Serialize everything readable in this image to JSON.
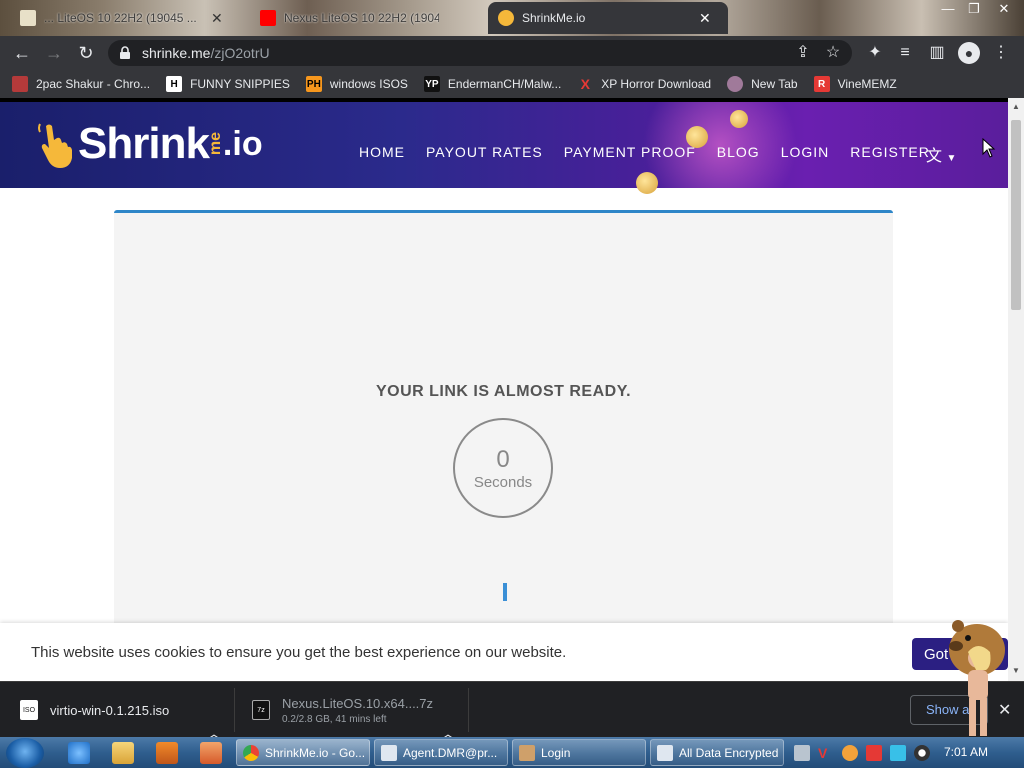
{
  "browser": {
    "tabs": [
      {
        "title": "... LiteOS 10 22H2 (19045 ..."
      },
      {
        "title": "Nexus LiteOS 10 22H2 (19045 ..."
      },
      {
        "title": "ShrinkMe.io"
      }
    ],
    "url_host": "shrinke.me",
    "url_path": "/zjO2otrU",
    "bookmarks": [
      {
        "label": "2pac Shakur - Chro...",
        "icon": "music-icon",
        "color": "#b43a3a"
      },
      {
        "label": "FUNNY SNIPPIES",
        "icon": "H",
        "color": "#ffffff"
      },
      {
        "label": "windows ISOS",
        "icon": "PH",
        "color": "#f7971d"
      },
      {
        "label": "EndermanCH/Malw...",
        "icon": "YP",
        "color": "#111111"
      },
      {
        "label": "XP Horror Download",
        "icon": "X",
        "color": "#e53935"
      },
      {
        "label": "New Tab",
        "icon": "avatar-icon",
        "color": "#a07a9a"
      },
      {
        "label": "VineMEMZ",
        "icon": "R",
        "color": "#e53935"
      }
    ]
  },
  "site": {
    "logo_word": "Shrink",
    "logo_me": "me",
    "logo_io": ".io",
    "nav": [
      "HOME",
      "PAYOUT RATES",
      "PAYMENT PROOF",
      "BLOG",
      "LOGIN",
      "REGISTER"
    ],
    "ready_text": "YOUR LINK IS ALMOST READY.",
    "timer_value": "0",
    "timer_label": "Seconds",
    "cookie_message": "This website uses cookies to ensure you get the best experience on our website.",
    "cookie_button": "Got it"
  },
  "downloads": [
    {
      "name": "virtio-win-0.1.215.iso",
      "status": "",
      "type": "ISO"
    },
    {
      "name": "Nexus.LiteOS.10.x64....7z",
      "status": "0.2/2.8 GB, 41 mins left",
      "type": "7z"
    }
  ],
  "downloads_show_all": "Show all",
  "taskbar": {
    "tasks": [
      {
        "label": "ShrinkMe.io - Go..."
      },
      {
        "label": "Agent.DMR@pr..."
      },
      {
        "label": "Login"
      },
      {
        "label": "All Data Encrypted"
      }
    ],
    "clock": "7:01 AM"
  },
  "colors": {
    "accent_blue": "#2e86c8",
    "cookie_button": "#2b1f82",
    "header_start": "#1a1f6b",
    "header_end": "#6a1fb0"
  }
}
